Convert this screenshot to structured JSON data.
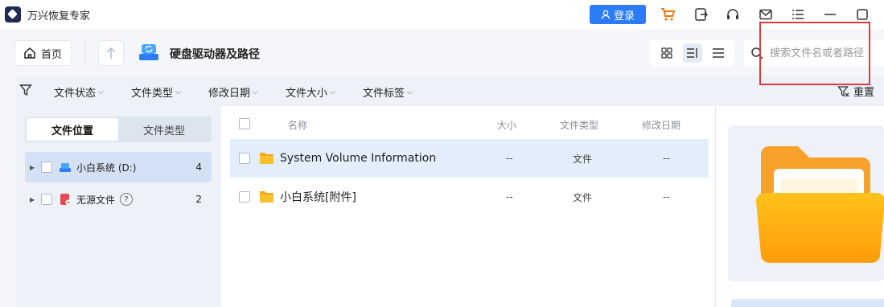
{
  "app": {
    "title": "万兴恢复专家"
  },
  "titlebar": {
    "login_label": "登录",
    "icons": [
      "cart-icon",
      "export-icon",
      "headset-icon",
      "mail-icon",
      "menu-icon",
      "minimize-icon",
      "maximize-icon"
    ],
    "accent": "#2b7cf6",
    "cart_color": "#f5740b"
  },
  "nav": {
    "home_label": "首页",
    "title": "硬盘驱动器及路径",
    "view_modes": [
      "grid-view-icon",
      "detail-view-icon",
      "list-view-icon"
    ],
    "active_view": "detail-view-icon"
  },
  "search": {
    "placeholder": "搜索文件名或者路径",
    "value": ""
  },
  "filters": {
    "items": [
      "文件状态",
      "文件类型",
      "修改日期",
      "文件大小",
      "文件标签"
    ],
    "reset_label": "重置"
  },
  "sidebar": {
    "tabs": [
      "文件位置",
      "文件类型"
    ],
    "active_tab": 0,
    "items": [
      {
        "label": "小白系统 (D:)",
        "count": "4",
        "icon": "drive-icon"
      },
      {
        "label": "无源文件",
        "count": "2",
        "icon": "lost-files-icon"
      }
    ],
    "help_glyph": "?"
  },
  "table": {
    "columns": [
      "名称",
      "大小",
      "文件类型",
      "修改日期"
    ],
    "rows": [
      {
        "name": "System Volume Information",
        "size": "--",
        "type": "文件",
        "modified": "--"
      },
      {
        "name": "小白系统[附件]",
        "size": "--",
        "type": "文件",
        "modified": "--"
      }
    ]
  },
  "colors": {
    "red_highlight": "#e0393e",
    "folder": "#fbb51a"
  }
}
